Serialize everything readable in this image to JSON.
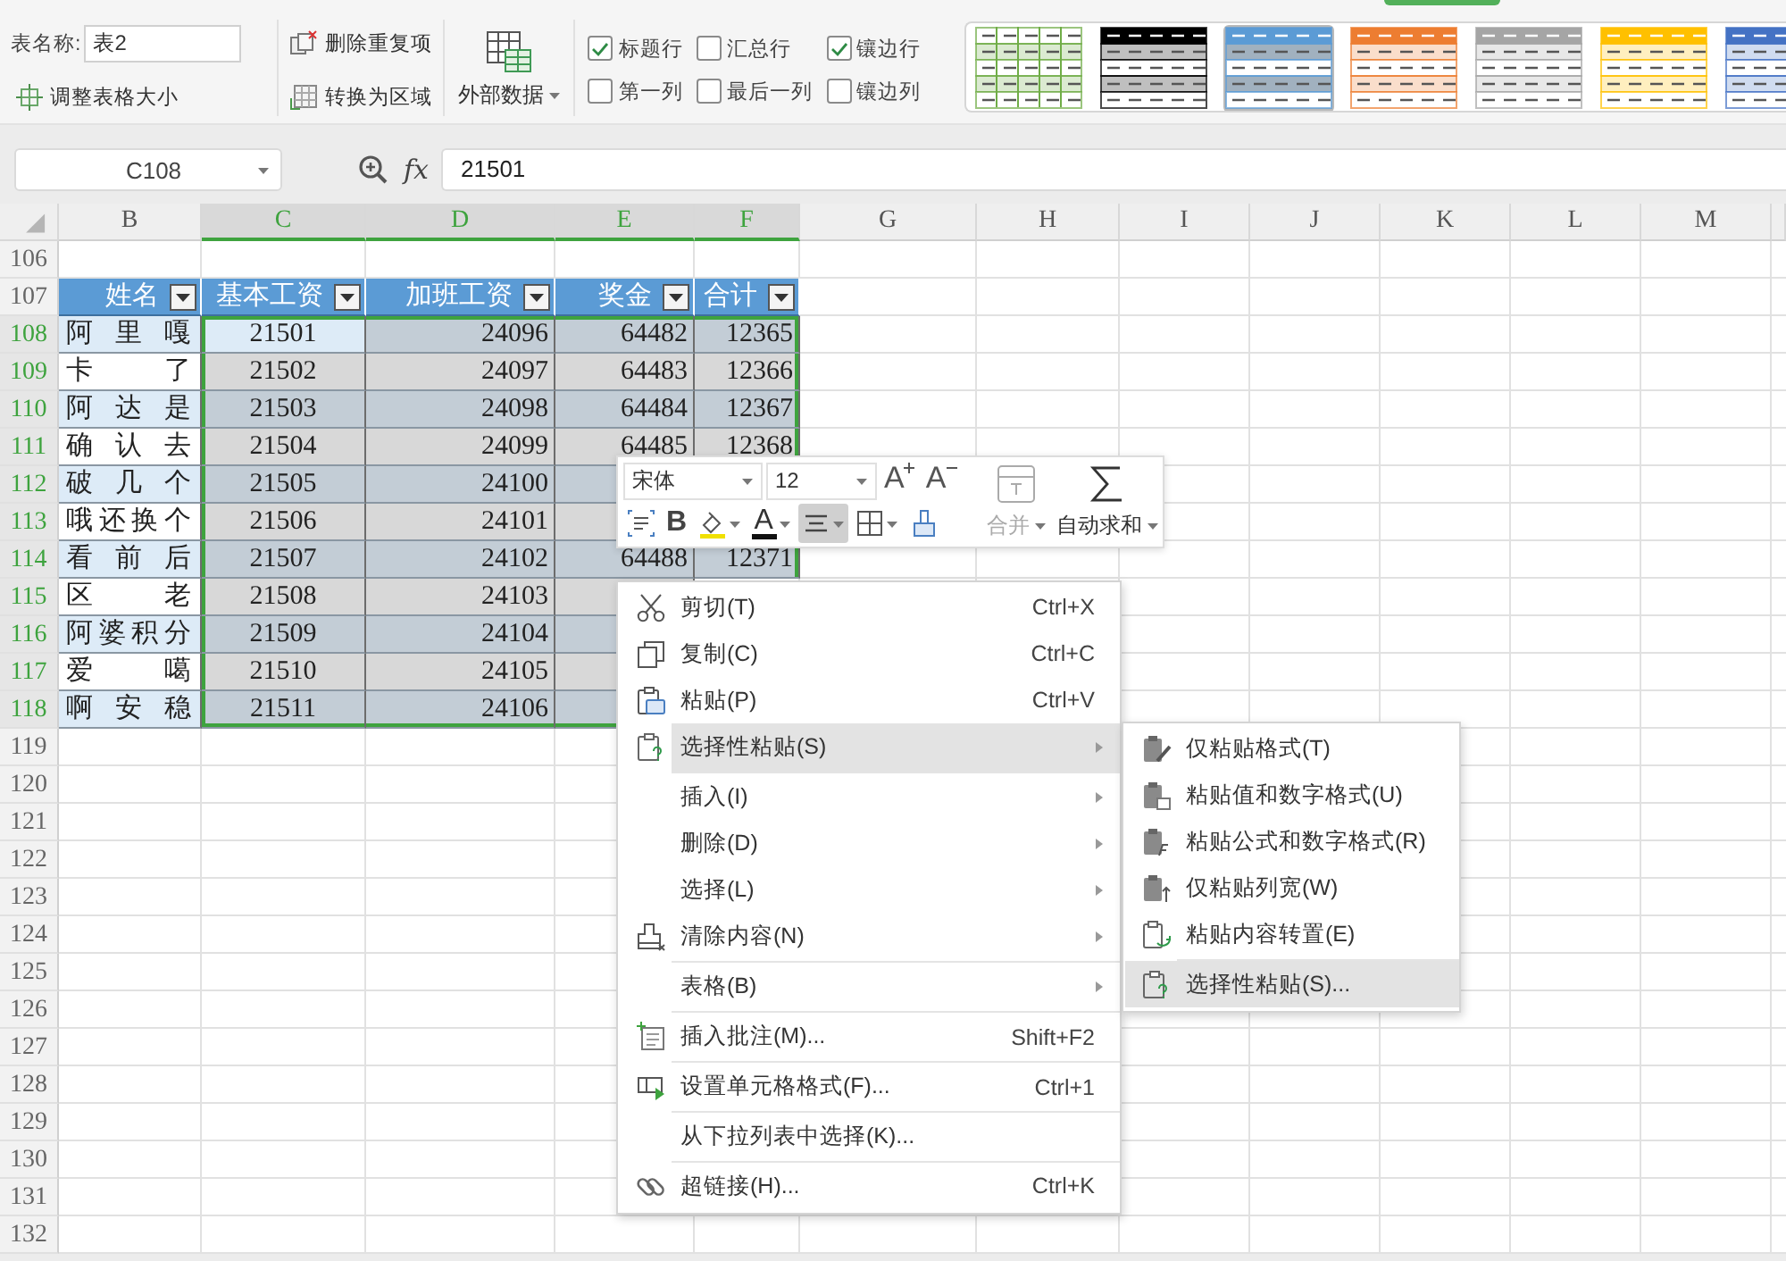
{
  "ribbon": {
    "table_name_label": "表名称:",
    "table_name": "表2",
    "resize_button": "调整表格大小",
    "remove_duplicates_button": "删除重复项",
    "convert_button": "转换为区域",
    "external_data_button": "外部数据",
    "options": [
      {
        "label": "标题行",
        "checked": true
      },
      {
        "label": "汇总行",
        "checked": false
      },
      {
        "label": "镶边行",
        "checked": true
      },
      {
        "label": "第一列",
        "checked": false
      },
      {
        "label": "最后一列",
        "checked": false
      },
      {
        "label": "镶边列",
        "checked": false
      }
    ],
    "table_styles": [
      {
        "kind": "grid",
        "color": "#70ad47",
        "selected": false
      },
      {
        "kind": "header",
        "color": "#000000",
        "selected": false
      },
      {
        "kind": "header",
        "color": "#5b9bd5",
        "selected": true
      },
      {
        "kind": "header",
        "color": "#ed7d31",
        "selected": false
      },
      {
        "kind": "header",
        "color": "#a5a5a5",
        "selected": false
      },
      {
        "kind": "header",
        "color": "#ffc000",
        "selected": false
      },
      {
        "kind": "header",
        "color": "#4472c4",
        "selected": false
      }
    ]
  },
  "formula_bar": {
    "name_box": "C108",
    "function_label": "fx",
    "value": "21501"
  },
  "sheet": {
    "columns": [
      {
        "letter": "B",
        "selected": false
      },
      {
        "letter": "C",
        "selected": true
      },
      {
        "letter": "D",
        "selected": true
      },
      {
        "letter": "E",
        "selected": true
      },
      {
        "letter": "F",
        "selected": true
      },
      {
        "letter": "G",
        "selected": false
      },
      {
        "letter": "H",
        "selected": false
      },
      {
        "letter": "I",
        "selected": false
      },
      {
        "letter": "J",
        "selected": false
      },
      {
        "letter": "K",
        "selected": false
      },
      {
        "letter": "L",
        "selected": false
      },
      {
        "letter": "M",
        "selected": false
      }
    ],
    "rows": [
      {
        "number": "106",
        "kind": "empty",
        "selected": false
      },
      {
        "number": "107",
        "kind": "header",
        "selected": false,
        "cells": [
          "姓名",
          "基本工资",
          "加班工资",
          "奖金",
          "合计"
        ]
      },
      {
        "number": "108",
        "kind": "data",
        "selected": true,
        "banded": true,
        "active": true,
        "cells": [
          "阿 里 嘎",
          "21501",
          "24096",
          "64482",
          "12365"
        ]
      },
      {
        "number": "109",
        "kind": "data",
        "selected": true,
        "banded": false,
        "cells": [
          "卡 了",
          "21502",
          "24097",
          "64483",
          "12366"
        ]
      },
      {
        "number": "110",
        "kind": "data",
        "selected": true,
        "banded": true,
        "cells": [
          "阿 达 是",
          "21503",
          "24098",
          "64484",
          "12367"
        ]
      },
      {
        "number": "111",
        "kind": "data",
        "selected": true,
        "banded": false,
        "cells": [
          "确 认 去",
          "21504",
          "24099",
          "64485",
          "12368"
        ]
      },
      {
        "number": "112",
        "kind": "data",
        "selected": true,
        "banded": true,
        "cells": [
          "破 几 个",
          "21505",
          "24100"
        ]
      },
      {
        "number": "113",
        "kind": "data",
        "selected": true,
        "banded": false,
        "cells": [
          "哦还换个",
          "21506",
          "24101"
        ]
      },
      {
        "number": "114",
        "kind": "data",
        "selected": true,
        "banded": true,
        "cells": [
          "看 前 后",
          "21507",
          "24102",
          "64488",
          "12371"
        ]
      },
      {
        "number": "115",
        "kind": "data",
        "selected": true,
        "banded": false,
        "cells": [
          "区 老",
          "21508",
          "24103"
        ]
      },
      {
        "number": "116",
        "kind": "data",
        "selected": true,
        "banded": true,
        "cells": [
          "阿婆积分",
          "21509",
          "24104"
        ]
      },
      {
        "number": "117",
        "kind": "data",
        "selected": true,
        "banded": false,
        "cells": [
          "爱 噶",
          "21510",
          "24105"
        ]
      },
      {
        "number": "118",
        "kind": "data",
        "selected": true,
        "banded": true,
        "cells": [
          "啊 安 稳",
          "21511",
          "24106"
        ]
      },
      {
        "number": "119",
        "kind": "empty",
        "selected": false
      },
      {
        "number": "120",
        "kind": "empty",
        "selected": false
      },
      {
        "number": "121",
        "kind": "empty",
        "selected": false
      },
      {
        "number": "122",
        "kind": "empty",
        "selected": false
      },
      {
        "number": "123",
        "kind": "empty",
        "selected": false
      },
      {
        "number": "124",
        "kind": "empty",
        "selected": false
      },
      {
        "number": "125",
        "kind": "empty",
        "selected": false
      },
      {
        "number": "126",
        "kind": "empty",
        "selected": false
      },
      {
        "number": "127",
        "kind": "empty",
        "selected": false
      },
      {
        "number": "128",
        "kind": "empty",
        "selected": false
      },
      {
        "number": "129",
        "kind": "empty",
        "selected": false
      },
      {
        "number": "130",
        "kind": "empty",
        "selected": false
      },
      {
        "number": "131",
        "kind": "empty",
        "selected": false
      },
      {
        "number": "132",
        "kind": "empty",
        "selected": false
      }
    ]
  },
  "mini_toolbar": {
    "font": "宋体",
    "size": "12",
    "grow_font": "A",
    "shrink_font": "A",
    "merge": {
      "label": "合并",
      "disabled": true
    },
    "autosum": "自动求和",
    "format_buttons": [
      {
        "kind": "wrap",
        "dropdown": false,
        "pressed": false
      },
      {
        "kind": "bold",
        "label": "B",
        "dropdown": false,
        "pressed": false
      },
      {
        "kind": "fill",
        "dropdown": true,
        "pressed": false
      },
      {
        "kind": "font-color",
        "label": "A",
        "dropdown": true,
        "pressed": false
      },
      {
        "kind": "align",
        "dropdown": true,
        "pressed": true
      },
      {
        "kind": "border",
        "dropdown": true,
        "pressed": false
      },
      {
        "kind": "painter",
        "dropdown": false,
        "pressed": false
      }
    ]
  },
  "context_menu": {
    "items": [
      {
        "label": "剪切(T)",
        "shortcut": "Ctrl+X",
        "submenu": false,
        "highlighted": false,
        "divider_after": false
      },
      {
        "label": "复制(C)",
        "shortcut": "Ctrl+C",
        "submenu": false,
        "highlighted": false,
        "divider_after": false
      },
      {
        "label": "粘贴(P)",
        "shortcut": "Ctrl+V",
        "submenu": false,
        "highlighted": false,
        "divider_after": false
      },
      {
        "label": "选择性粘贴(S)",
        "submenu": true,
        "highlighted": true,
        "divider_after": true
      },
      {
        "label": "插入(I)",
        "submenu": true,
        "highlighted": false,
        "divider_after": false
      },
      {
        "label": "删除(D)",
        "submenu": true,
        "highlighted": false,
        "divider_after": false
      },
      {
        "label": "选择(L)",
        "submenu": true,
        "highlighted": false,
        "divider_after": false
      },
      {
        "label": "清除内容(N)",
        "submenu": true,
        "highlighted": false,
        "divider_after": true
      },
      {
        "label": "表格(B)",
        "submenu": true,
        "highlighted": false,
        "divider_after": true
      },
      {
        "label": "插入批注(M)...",
        "shortcut": "Shift+F2",
        "submenu": false,
        "highlighted": false,
        "divider_after": true
      },
      {
        "label": "设置单元格格式(F)...",
        "shortcut": "Ctrl+1",
        "submenu": false,
        "highlighted": false,
        "divider_after": true
      },
      {
        "label": "从下拉列表中选择(K)...",
        "submenu": false,
        "highlighted": false,
        "divider_after": true
      },
      {
        "label": "超链接(H)...",
        "shortcut": "Ctrl+K",
        "submenu": false,
        "highlighted": false,
        "divider_after": false
      }
    ]
  },
  "submenu": {
    "items": [
      {
        "label": "仅粘贴格式(T)",
        "highlighted": false,
        "divider_after": false
      },
      {
        "label": "粘贴值和数字格式(U)",
        "highlighted": false,
        "divider_after": false
      },
      {
        "label": "粘贴公式和数字格式(R)",
        "highlighted": false,
        "divider_after": false
      },
      {
        "label": "仅粘贴列宽(W)",
        "highlighted": false,
        "divider_after": false
      },
      {
        "label": "粘贴内容转置(E)",
        "highlighted": false,
        "divider_after": true
      },
      {
        "label": "选择性粘贴(S)...",
        "highlighted": true,
        "divider_after": false
      }
    ]
  }
}
